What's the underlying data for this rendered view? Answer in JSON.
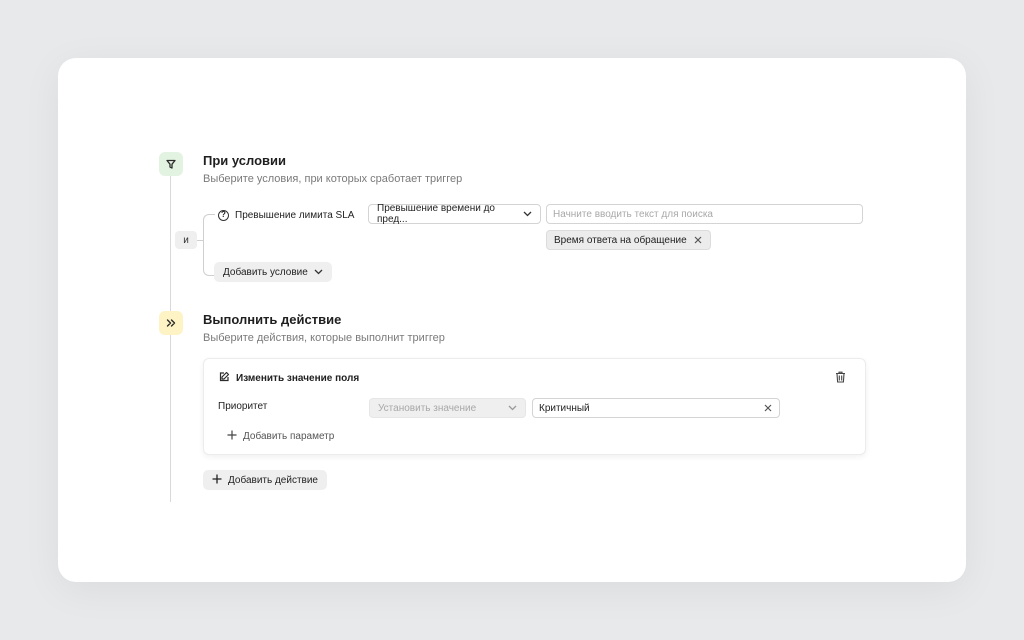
{
  "condition": {
    "title": "При условии",
    "subtitle": "Выберите условия, при которых сработает триггер",
    "and_label": "и",
    "rule": {
      "label": "Превышение лимита SLA",
      "operator": "Превышение времени до пред...",
      "search_placeholder": "Начните вводить текст для поиска",
      "chip": "Время ответа на обращение"
    },
    "add_button": "Добавить условие"
  },
  "action": {
    "title": "Выполнить действие",
    "subtitle": "Выберите действия, которые выполнит триггер",
    "card": {
      "heading": "Изменить значение поля",
      "field_label": "Приоритет",
      "mode_select": "Установить значение",
      "value": "Критичный",
      "add_param": "Добавить параметр"
    },
    "add_button": "Добавить действие"
  },
  "icons": {
    "condition_step": "filter-icon",
    "action_step": "double-chevron-right-icon",
    "question": "question-circle-icon",
    "edit": "edit-icon",
    "trash": "trash-icon",
    "plus": "plus-icon",
    "close": "close-icon",
    "chevron": "chevron-down-icon"
  },
  "colors": {
    "condition_badge": "#e3f3e1",
    "action_badge": "#fdf3c4"
  }
}
